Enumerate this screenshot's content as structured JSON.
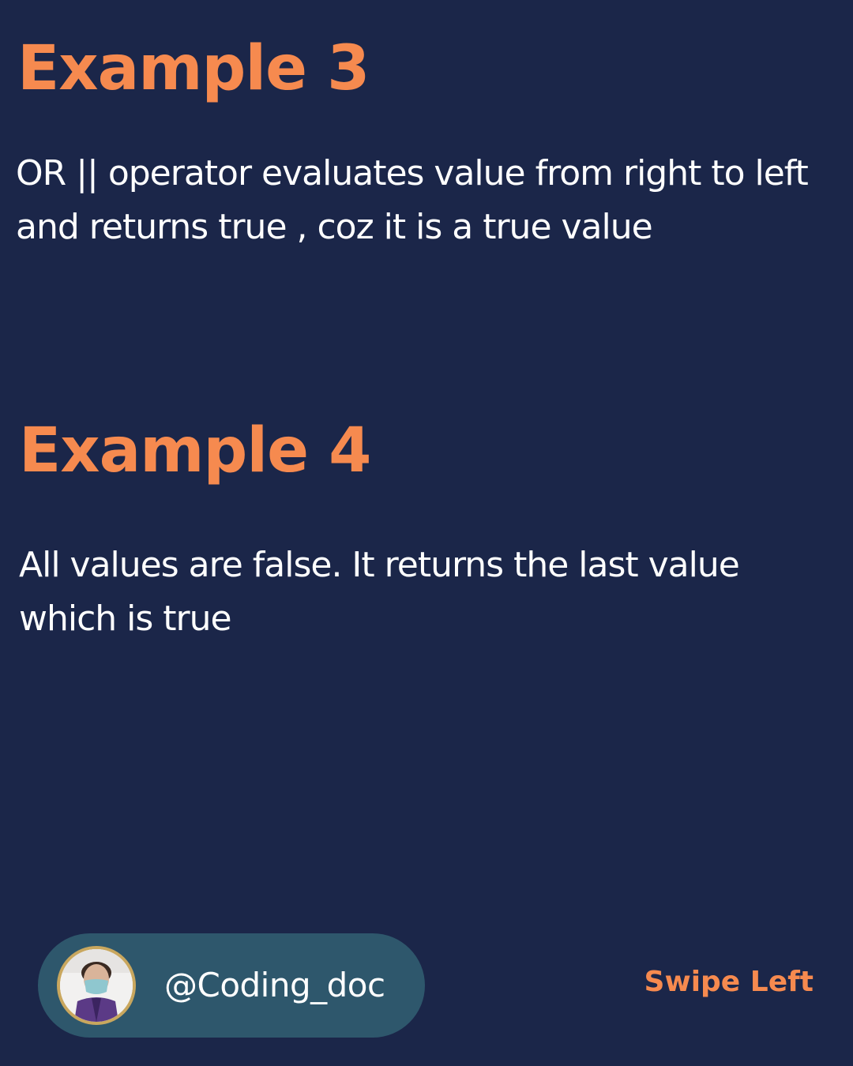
{
  "example3": {
    "title": "Example 3",
    "text": "OR || operator evaluates value from right to left and returns true , coz it is a true value"
  },
  "example4": {
    "title": "Example 4",
    "text": "All values are false. It returns the last value which is true"
  },
  "profile": {
    "handle": "@Coding_doc",
    "avatar_icon": "person-avatar-photo"
  },
  "footer": {
    "swipe_label": "Swipe Left"
  },
  "colors": {
    "background": "#1b2649",
    "accent": "#f68a4f",
    "text": "#ffffff",
    "pill": "#2e576c",
    "avatar_ring": "#c9a75e"
  }
}
